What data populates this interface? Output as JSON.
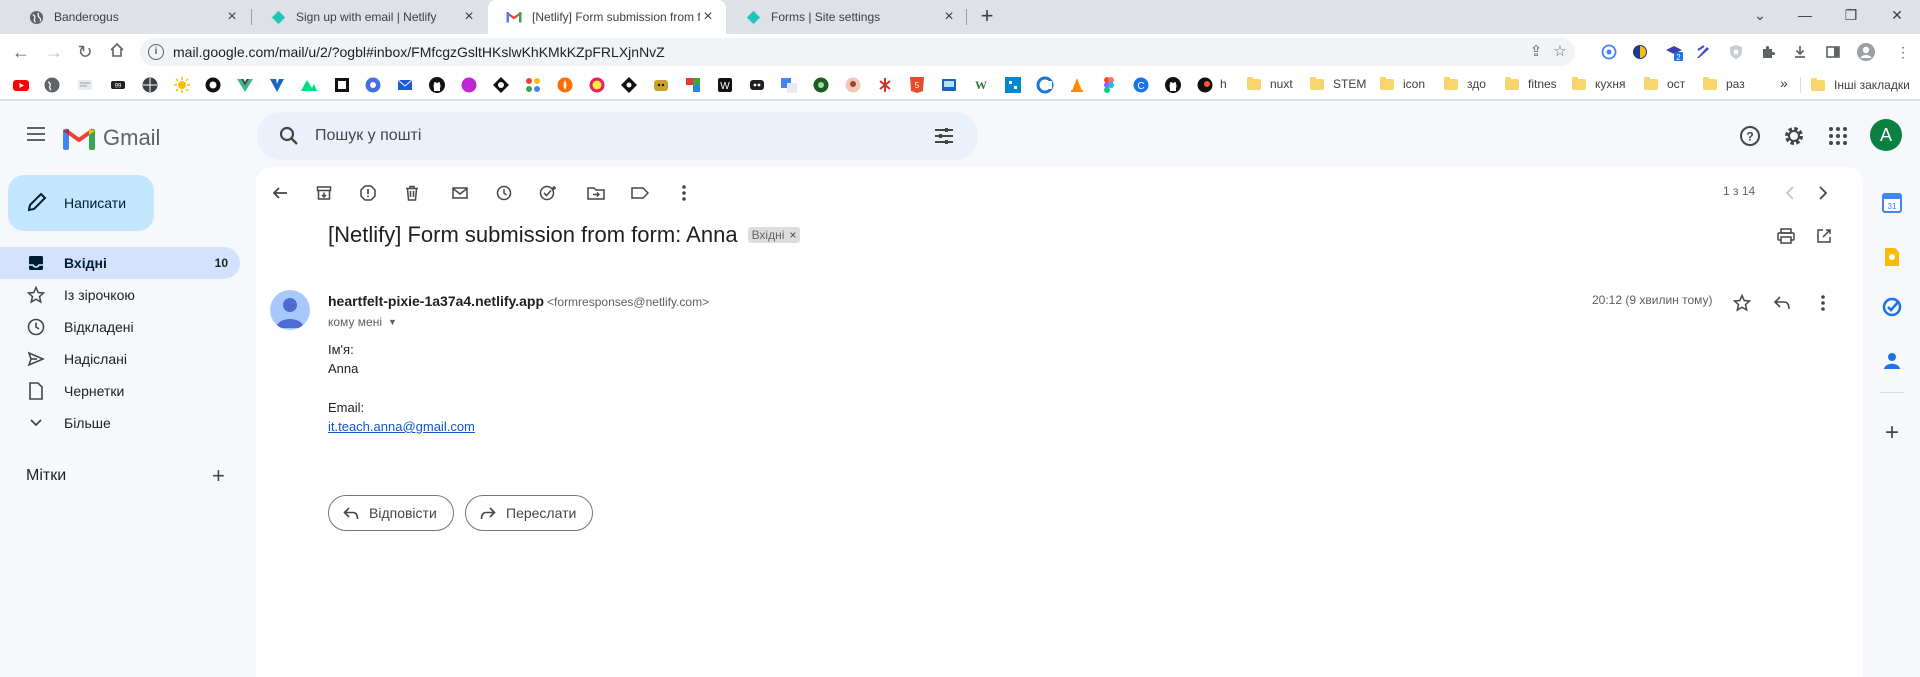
{
  "browser": {
    "tabs": [
      {
        "title": "Banderogus",
        "icon": "globe-icon"
      },
      {
        "title": "Sign up with email | Netlify",
        "icon": "netlify-icon"
      },
      {
        "title": "[Netlify] Form submission from fo",
        "icon": "gmail-icon"
      },
      {
        "title": "Forms | Site settings",
        "icon": "netlify-icon"
      }
    ],
    "url": "mail.google.com/mail/u/2/?ogbl#inbox/FMfcgzGsltHKslwKhKMkKZpFRLXjnNvZ",
    "extension_badge": "2",
    "bookmark_folders": [
      "h",
      "nuxt",
      "STEM",
      "icon",
      "здо",
      "fitnes",
      "кухня",
      "ост",
      "раз"
    ],
    "more_bookmarks": "»",
    "other_bookmarks": "Інші закладки"
  },
  "gmail": {
    "logo_text": "Gmail",
    "search_placeholder": "Пошук у пошті",
    "avatar_letter": "A",
    "compose_label": "Написати",
    "nav": [
      {
        "label": "Вхідні",
        "count": "10",
        "icon": "inbox-icon"
      },
      {
        "label": "Із зірочкою",
        "count": "",
        "icon": "star-icon"
      },
      {
        "label": "Відкладені",
        "count": "",
        "icon": "clock-icon"
      },
      {
        "label": "Надіслані",
        "count": "",
        "icon": "send-icon"
      },
      {
        "label": "Чернетки",
        "count": "",
        "icon": "draft-icon"
      },
      {
        "label": "Більше",
        "count": "",
        "icon": "chevron-down-icon"
      }
    ],
    "labels_heading": "Мітки",
    "pager": "1 з 14",
    "subject": "[Netlify] Form submission from form: Anna",
    "label_chip": "Вхідні",
    "sender_name": "heartfelt-pixie-1a37a4.netlify.app",
    "sender_email": "<formresponses@netlify.com>",
    "to_me": "кому мені",
    "time": "20:12 (9 хвилин тому)",
    "body": {
      "name_label": "Ім'я:",
      "name_value": "Anna",
      "email_label": "Email:",
      "email_value": "it.teach.anna@gmail.com"
    },
    "reply_label": "Відповісти",
    "forward_label": "Переслати"
  }
}
